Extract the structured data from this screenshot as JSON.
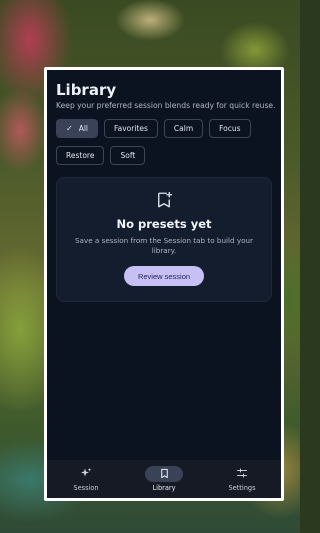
{
  "library": {
    "title": "Library",
    "subtitle": "Keep your preferred session blends ready for quick reuse."
  },
  "filters": [
    {
      "label": "All",
      "selected": true
    },
    {
      "label": "Favorites",
      "selected": false
    },
    {
      "label": "Calm",
      "selected": false
    },
    {
      "label": "Focus",
      "selected": false
    },
    {
      "label": "Restore",
      "selected": false
    },
    {
      "label": "Soft",
      "selected": false
    }
  ],
  "empty_state": {
    "icon": "bookmark-add-icon",
    "title": "No presets yet",
    "description": "Save a session from the Session tab to build your library.",
    "button_label": "Review session"
  },
  "nav": {
    "items": [
      {
        "label": "Session",
        "icon": "sparkle-icon",
        "active": false
      },
      {
        "label": "Library",
        "icon": "bookmark-icon",
        "active": true
      },
      {
        "label": "Settings",
        "icon": "sliders-icon",
        "active": false
      }
    ]
  },
  "colors": {
    "background": "#0c1320",
    "card": "#141d2d",
    "accent_button": "#c6c0f5",
    "selected_chip": "#3a4258"
  }
}
